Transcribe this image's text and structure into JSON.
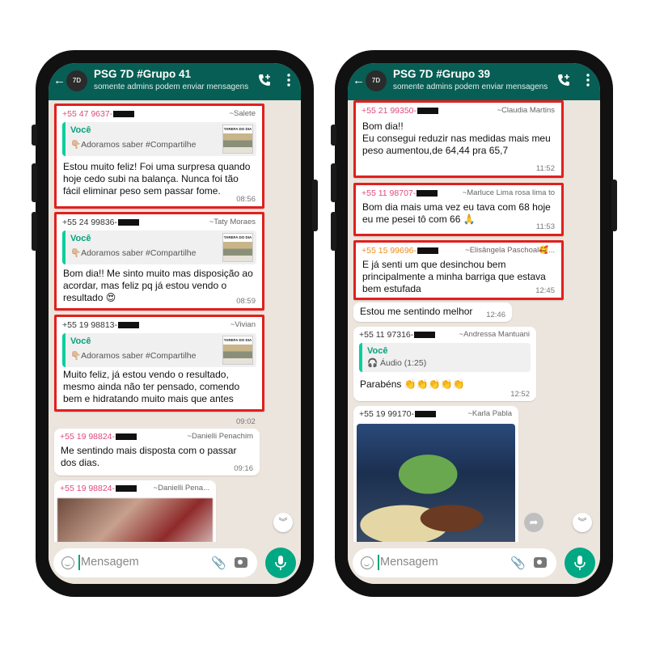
{
  "left": {
    "header": {
      "avatar_text": "7D",
      "title": "PSG 7D #Grupo 41",
      "subtitle": "somente admins podem enviar mensagens"
    },
    "messages": [
      {
        "number": "+55 47 9637-",
        "alias": "~Salete",
        "quote_author": "Você",
        "quote_text": "👇🏼Adoramos saber #Compartilhe",
        "thumb_text": "TAREFA DO DIA",
        "text": "Estou muito feliz! Foi uma surpresa quando hoje cedo subi na balança. Nunca foi tão fácil eliminar peso sem passar fome.",
        "time": "08:56"
      },
      {
        "number": "+55 24 99836-",
        "alias": "~Taty Moraes",
        "quote_author": "Você",
        "quote_text": "👇🏼Adoramos saber #Compartilhe",
        "thumb_text": "TAREFA DO DIA",
        "text": "Bom dia!! Me sinto muito mas disposição ao acordar,  mas feliz pq já estou vendo o resultado 😍",
        "time": "08:59"
      },
      {
        "number": "+55 19 98813-",
        "alias": "~Vivian",
        "quote_author": "Você",
        "quote_text": "👇🏼Adoramos saber #Compartilhe",
        "thumb_text": "TAREFA DO DIA",
        "text": "Muito feliz, já estou vendo o resultado, mesmo ainda não ter pensado, comendo bem e hidratando muito mais que antes",
        "time": "09:02"
      },
      {
        "number": "+55 19 98824-",
        "alias": "~Danielli Penachim",
        "text": "Me sentindo mais disposta com o passar dos dias.",
        "time": "09:16"
      },
      {
        "number": "+55 19 98824-",
        "alias": "~Danielli Pena..."
      }
    ],
    "composer_placeholder": "Mensagem"
  },
  "right": {
    "header": {
      "avatar_text": "7D",
      "title": "PSG 7D #Grupo 39",
      "subtitle": "somente admins podem enviar mensagens"
    },
    "messages": [
      {
        "number": "+55 21 99350-",
        "alias": "~Claudia Martins",
        "text": "Bom dia!!\nEu consegui reduzir nas medidas mais meu peso aumentou,de 64,44 pra 65,7",
        "time": "11:52"
      },
      {
        "number": "+55 11 98707-",
        "alias": "~Marluce Lima rosa lima to",
        "text": "Bom dia mais uma vez eu tava com 68 hoje eu me pesei tô com 66 🙏",
        "time": "11:53"
      },
      {
        "number": "+55 15 99696-",
        "alias": "~Elisângela Paschoal🥰...",
        "text": "E já senti um que desinchou bem principalmente a minha barriga que estava bem estufada",
        "time": "12:45"
      },
      {
        "text": "Estou me sentindo melhor",
        "time": "12:46"
      },
      {
        "number": "+55 11 97316-",
        "alias": "~Andressa Mantuani",
        "quote_author": "Você",
        "quote_text": "🎧 Áudio (1:25)",
        "text": "Parabéns 👏👏👏👏👏",
        "time": "12:52"
      },
      {
        "number": "+55 19 99170-",
        "alias": "~Karla Pabla"
      }
    ],
    "composer_placeholder": "Mensagem"
  },
  "colors": {
    "header": "#075e54",
    "highlight": "#e0201e",
    "chat_bg": "#ece5dd",
    "mic": "#00a884",
    "quote_bar": "#06cf9c"
  }
}
